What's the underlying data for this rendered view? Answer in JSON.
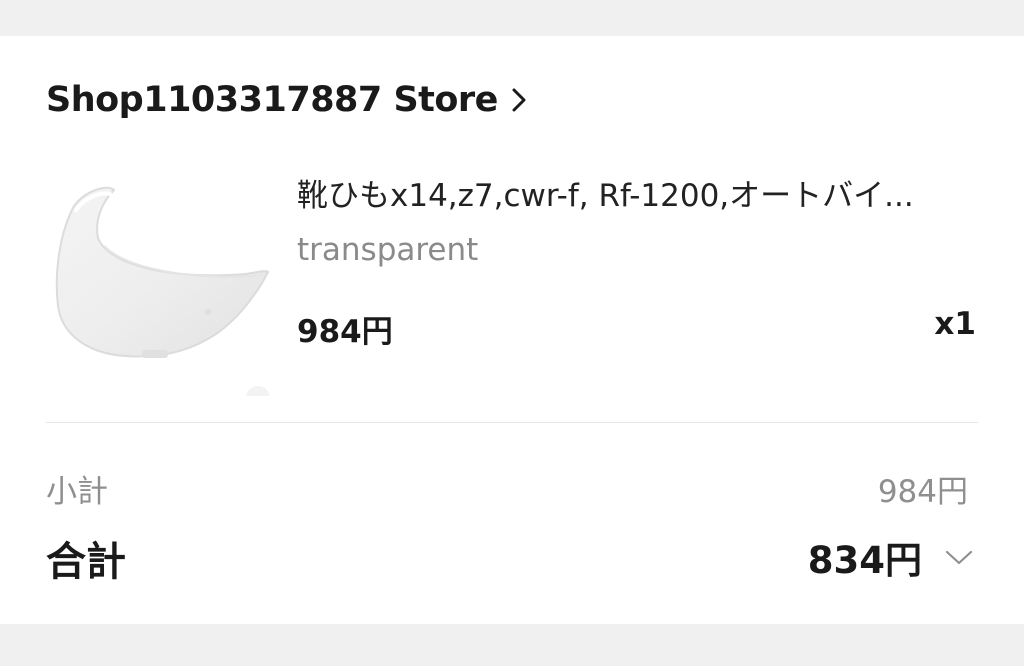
{
  "store": {
    "name": "Shop1103317887 Store",
    "chevron_icon": "chevron-right-icon"
  },
  "item": {
    "image_icon": "transparent-helmet-visor-image",
    "title": "靴ひもx14,z7,cwr-f, Rf-1200,オートバイ...",
    "variant": "transparent",
    "price": "984円",
    "quantity": "x1"
  },
  "summary": {
    "subtotal_label": "小計",
    "subtotal_value": "984円",
    "total_label": "合計",
    "total_value": "834円",
    "expand_icon": "chevron-down-icon"
  },
  "colors": {
    "page_background": "#f0f0f0",
    "card_background": "#ffffff",
    "primary_text": "#1a1a1a",
    "secondary_text": "#8a8a8a",
    "divider": "#e6e6e6"
  }
}
